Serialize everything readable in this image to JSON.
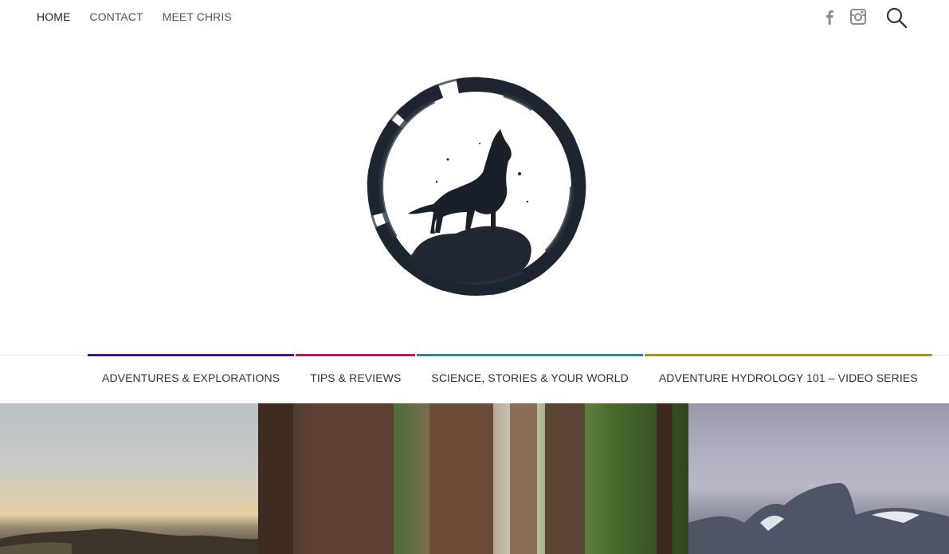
{
  "topnav": {
    "items": [
      {
        "label": "HOME",
        "active": true
      },
      {
        "label": "CONTACT",
        "active": false
      },
      {
        "label": "MEET CHRIS",
        "active": false
      }
    ]
  },
  "social": {
    "icons": [
      "facebook-icon",
      "instagram-icon"
    ],
    "icon_color": "#888888"
  },
  "search": {
    "icon": "search-icon"
  },
  "categories": [
    {
      "label": "ADVENTURES & EXPLORATIONS",
      "color": "#4b0f8f"
    },
    {
      "label": "TIPS & REVIEWS",
      "color": "#b5195f"
    },
    {
      "label": "SCIENCE, STORIES & YOUR WORLD",
      "color": "#2a8a8e"
    },
    {
      "label": "ADVENTURE HYDROLOGY 101 – VIDEO SERIES",
      "color": "#a7951d"
    }
  ],
  "logo": {
    "icon": "howling-wolf-logo"
  }
}
